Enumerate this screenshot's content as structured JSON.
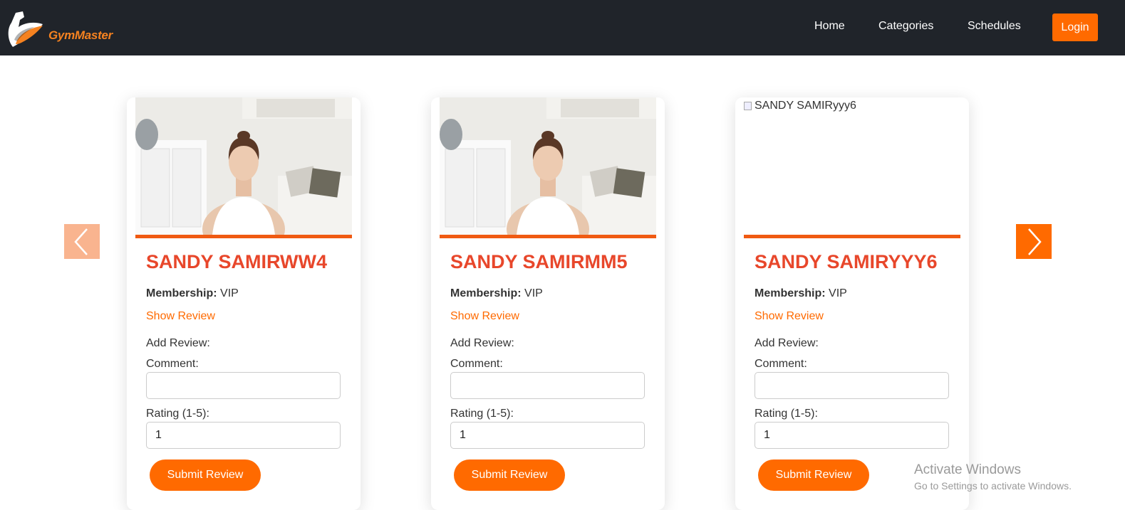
{
  "brand": {
    "name": "GymMaster",
    "accent": "#ff6a00"
  },
  "nav": {
    "home": "Home",
    "categories": "Categories",
    "schedules": "Schedules",
    "login": "Login"
  },
  "carousel": {
    "prev_icon": "chevron-left-icon",
    "next_icon": "chevron-right-icon"
  },
  "cards": [
    {
      "name": "SANDY SAMIRWW4",
      "image_alt": "",
      "membership_label": "Membership:",
      "membership_value": "VIP",
      "show_review": "Show Review",
      "add_review": "Add Review:",
      "comment_label": "Comment:",
      "comment_value": "",
      "rating_label": "Rating (1-5):",
      "rating_value": "1",
      "submit": "Submit Review"
    },
    {
      "name": "SANDY SAMIRMM5",
      "image_alt": "",
      "membership_label": "Membership:",
      "membership_value": "VIP",
      "show_review": "Show Review",
      "add_review": "Add Review:",
      "comment_label": "Comment:",
      "comment_value": "",
      "rating_label": "Rating (1-5):",
      "rating_value": "1",
      "submit": "Submit Review"
    },
    {
      "name": "SANDY SAMIRYYY6",
      "image_alt": "SANDY SAMIRyyy6",
      "membership_label": "Membership:",
      "membership_value": "VIP",
      "show_review": "Show Review",
      "add_review": "Add Review:",
      "comment_label": "Comment:",
      "comment_value": "",
      "rating_label": "Rating (1-5):",
      "rating_value": "1",
      "submit": "Submit Review"
    }
  ],
  "watermark": {
    "title": "Activate Windows",
    "subtitle": "Go to Settings to activate Windows."
  }
}
